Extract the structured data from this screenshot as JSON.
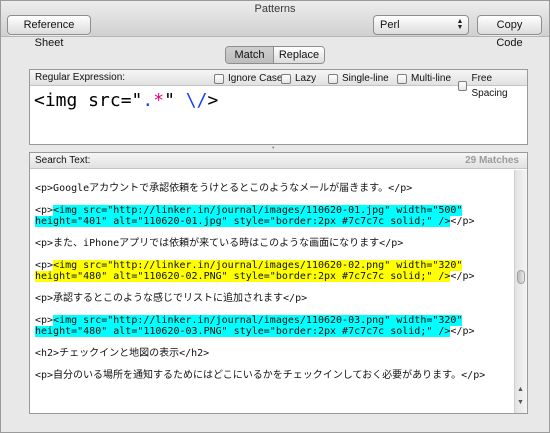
{
  "window": {
    "title": "Patterns"
  },
  "toolbar": {
    "reference_label": "Reference Sheet",
    "language": "Perl",
    "copy_label": "Copy Code"
  },
  "mode_tabs": [
    {
      "label": "Match",
      "selected": true
    },
    {
      "label": "Replace",
      "selected": false
    }
  ],
  "regex": {
    "header": "Regular Expression:",
    "options": [
      {
        "label": "Ignore Case",
        "checked": false
      },
      {
        "label": "Lazy",
        "checked": false
      },
      {
        "label": "Single-line",
        "checked": false
      },
      {
        "label": "Multi-line",
        "checked": false
      },
      {
        "label": "Free Spacing",
        "checked": false
      }
    ],
    "pattern_parts": [
      "<img src=\"",
      ".",
      "*",
      "\" ",
      "\\/",
      ">"
    ]
  },
  "search": {
    "header": "Search Text:",
    "matches": "29 Matches",
    "lines": {
      "l1": "<p>Googleアカウントで承認依頼をうけとるとこのようなメールが届きます。</p>",
      "l2_pre": "<p>",
      "l2_hl": "<img src=\"http://linker.in/journal/images/110620-01.jpg\" width=\"500\"",
      "l3_hl": "height=\"401\" alt=\"110620-01.jpg\" style=\"border:2px #7c7c7c solid;\" />",
      "l3_post": "</p>",
      "l4": "<p>また、iPhoneアプリでは依頼が来ている時はこのような画面になります</p>",
      "l5_pre": "<p>",
      "l5_hl": "<img src=\"http://linker.in/journal/images/110620-02.png\" width=\"320\"",
      "l6_hl": "height=\"480\" alt=\"110620-02.PNG\" style=\"border:2px #7c7c7c solid;\" />",
      "l6_post": "</p>",
      "l7": "<p>承認するとこのような感じでリストに追加されます</p>",
      "l8_pre": "<p>",
      "l8_hl": "<img src=\"http://linker.in/journal/images/110620-03.png\" width=\"320\"",
      "l9_hl": "height=\"480\" alt=\"110620-03.PNG\" style=\"border:2px #7c7c7c solid;\" />",
      "l9_post": "</p>",
      "l10": "<h2>チェックインと地図の表示</h2>",
      "l11": "<p>自分のいる場所を通知するためにはどこにいるかをチェックインしておく必要があります。</p>"
    }
  },
  "colors": {
    "match_highlight_1": "#00ffff",
    "match_highlight_2": "#ffff00",
    "pattern_metachar": "#1a3cff",
    "pattern_quantifier": "#e0007a"
  }
}
